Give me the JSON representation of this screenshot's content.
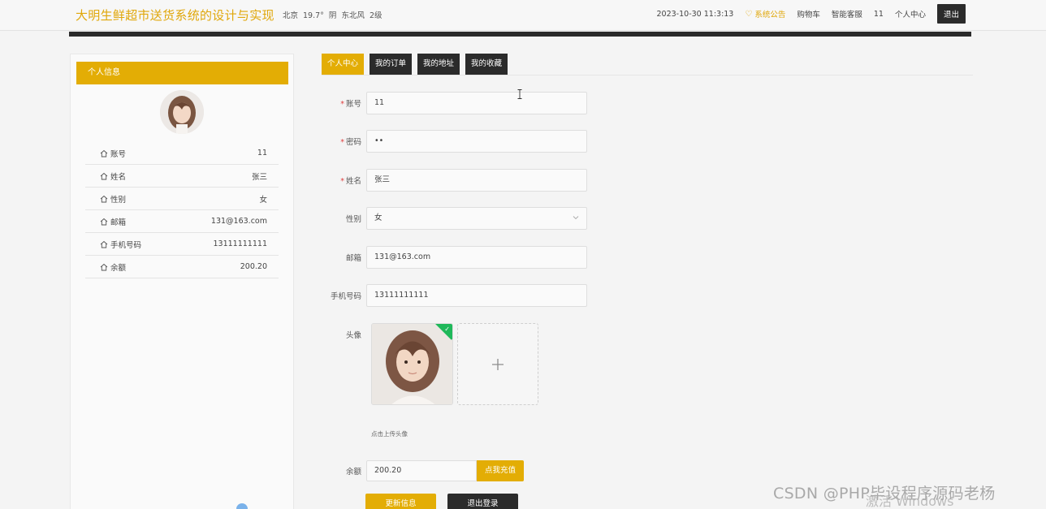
{
  "header": {
    "site_title": "大明生鲜超市送货系统的设计与实现",
    "weather": {
      "city": "北京",
      "temp": "19.7°",
      "condition": "阴",
      "wind": "东北风",
      "level": "2级"
    },
    "datetime": "2023-10-30 11:3:13",
    "notice": "系统公告",
    "cart": "购物车",
    "service": "智能客服",
    "user": "11",
    "center": "个人中心",
    "logout": "退出"
  },
  "profile_panel": {
    "title": "个人信息",
    "rows": [
      {
        "label": "账号",
        "value": "11"
      },
      {
        "label": "姓名",
        "value": "张三"
      },
      {
        "label": "性别",
        "value": "女"
      },
      {
        "label": "邮箱",
        "value": "131@163.com"
      },
      {
        "label": "手机号码",
        "value": "13111111111"
      },
      {
        "label": "余额",
        "value": "200.20"
      }
    ]
  },
  "tabs": [
    {
      "label": "个人中心",
      "active": true
    },
    {
      "label": "我的订单",
      "active": false
    },
    {
      "label": "我的地址",
      "active": false
    },
    {
      "label": "我的收藏",
      "active": false
    }
  ],
  "form": {
    "account": {
      "label": "账号",
      "value": "11"
    },
    "password": {
      "label": "密码",
      "value": "••"
    },
    "name": {
      "label": "姓名",
      "value": "张三"
    },
    "gender": {
      "label": "性别",
      "value": "女"
    },
    "email": {
      "label": "邮箱",
      "value": "131@163.com"
    },
    "phone": {
      "label": "手机号码",
      "value": "13111111111"
    },
    "avatar": {
      "label": "头像",
      "hint": "点击上传头像"
    },
    "balance": {
      "label": "余额",
      "value": "200.20",
      "recharge": "点我充值"
    }
  },
  "actions": {
    "update": "更新信息",
    "logout": "退出登录"
  },
  "overlay": {
    "watermark": "CSDN @PHP毕设程序源码老杨",
    "activate": "激活 Windows"
  },
  "colors": {
    "accent": "#e3ad05",
    "dark": "#2b2b2b",
    "success": "#1fb85a"
  }
}
